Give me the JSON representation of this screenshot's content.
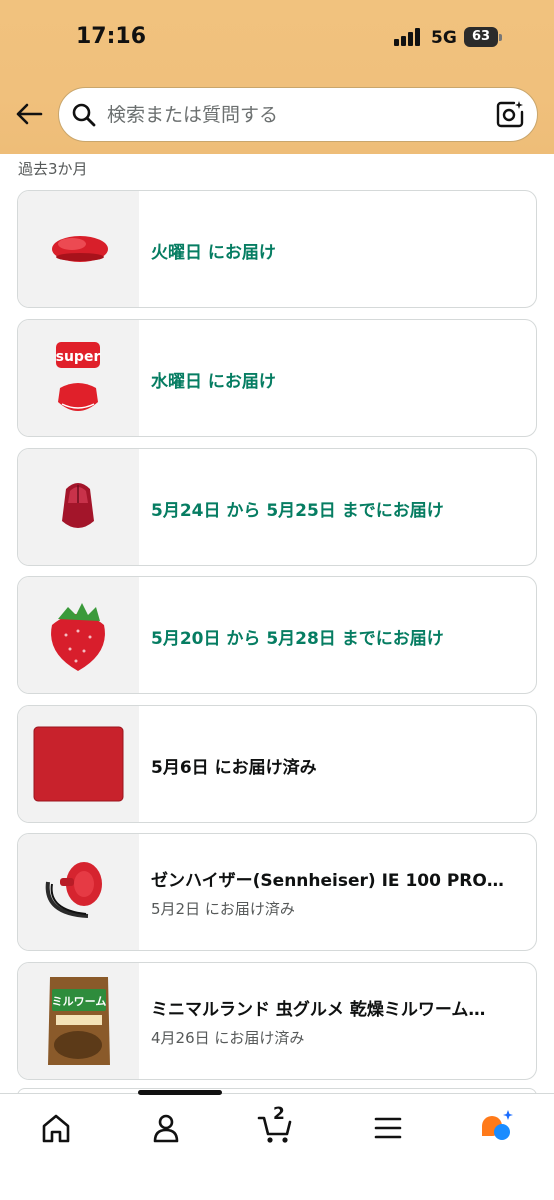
{
  "status": {
    "time": "17:16",
    "network": "5G",
    "battery": "63"
  },
  "search": {
    "placeholder": "検索または質問する"
  },
  "section_label": "過去3か月",
  "orders": [
    {
      "title": "火曜日 にお届け",
      "subtitle": "",
      "style": "green",
      "image": "red-gaming-mouse"
    },
    {
      "title": "水曜日 にお届け",
      "subtitle": "",
      "style": "green",
      "image": "red-mouse-skates"
    },
    {
      "title": "5月24日 から 5月25日 までにお届け",
      "subtitle": "",
      "style": "green",
      "image": "translucent-red-mouse"
    },
    {
      "title": "5月20日 から 5月28日 までにお届け",
      "subtitle": "",
      "style": "green",
      "image": "strawberry-pouch"
    },
    {
      "title": "5月6日 にお届け済み",
      "subtitle": "",
      "style": "dark",
      "image": "red-mouse-pad"
    },
    {
      "title": "ゼンハイザー(Sennheiser) IE 100 PRO…",
      "subtitle": "5月2日 にお届け済み",
      "style": "dark",
      "image": "red-in-ear-monitor"
    },
    {
      "title": "ミニマルランド 虫グルメ 乾燥ミルワーム…",
      "subtitle": "4月26日 にお届け済み",
      "style": "dark",
      "image": "mealworm-snack-bag"
    }
  ],
  "nav": {
    "cart_count": "2"
  },
  "colors": {
    "accent_green": "#067d62",
    "header_bg": "#f0c07c"
  }
}
